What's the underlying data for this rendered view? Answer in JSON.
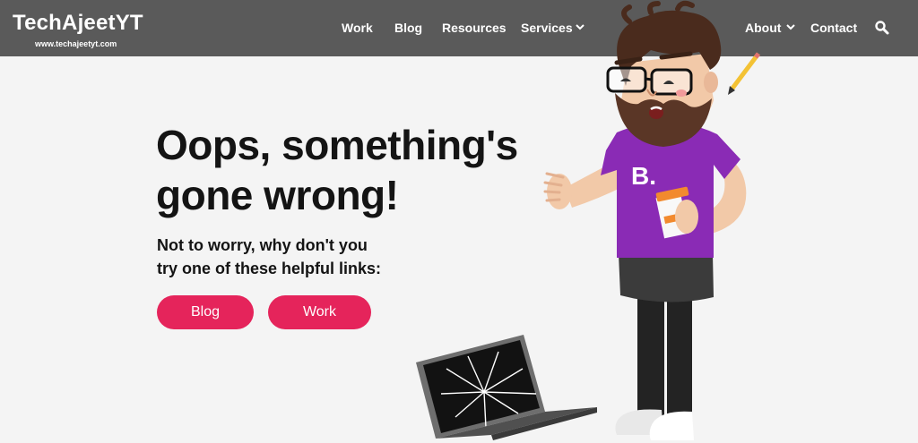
{
  "brand": {
    "name": "TechAjeetYT",
    "url": "www.techajeetyt.com"
  },
  "nav": {
    "items": [
      {
        "label": "Work"
      },
      {
        "label": "Blog"
      },
      {
        "label": "Resources"
      },
      {
        "label": "Services",
        "has_dropdown": true
      },
      {
        "label": "About",
        "has_dropdown": true
      },
      {
        "label": "Contact"
      }
    ],
    "search_icon": "search-icon"
  },
  "hero": {
    "headline_1": "Oops, something's",
    "headline_2": "gone wrong!",
    "subtext_1": "Not to worry, why don't you",
    "subtext_2": "try one of these helpful links:",
    "buttons": [
      {
        "label": "Blog"
      },
      {
        "label": "Work"
      }
    ]
  },
  "illustration": {
    "shirt_letter": "B."
  },
  "colors": {
    "header": "#5a5a5a",
    "background": "#f4f4f4",
    "accent": "#e5245b",
    "shirt": "#8a2bb5",
    "text": "#141414"
  }
}
